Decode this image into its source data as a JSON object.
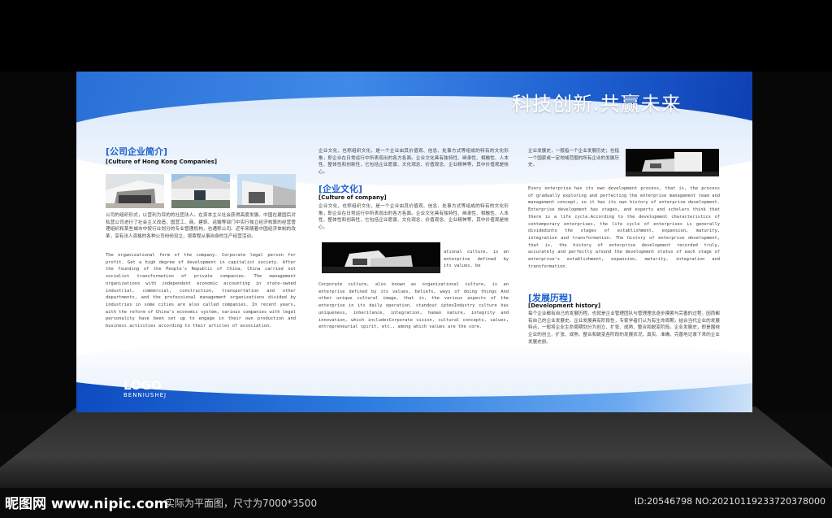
{
  "slogan": "科技创新.共赢未来",
  "logo": {
    "text": "LOGO",
    "sub": "BENNIUSHEJ"
  },
  "about": {
    "title_cn": "[公司企业简介]",
    "title_en": "[Culture of Hong Kong Companies]",
    "body_cn": "公司的组织形式，以营利为目的的社团法人。在资本主义社会获得高度发展。中国在建国后对私营公司进行了社会主义改造，国营工、商、建筑、运输等部门中实行独立经济核算的经营管理组织和某些城市中按行业划分的专业管理机构，也通称公司。近年来随着中国经济体制的改革，享有法人资格的各种公司纷纷设立，按章程从事自身的生产经营活动。",
    "body_en": "The organizational form of the company. Corporate legal person for profit. Get a high degree of development in capitalist society. After the founding of the People's Republic of China, China carried out socialist transformation of private companies. The management organizations with independent economic accounting in state-owned industrial, commercial, construction, transportation and other departments, and the professional management organizations divided by industries in some cities are also called companies. In recent years, with the reform of China's economic system, various companies with legal personality have been set up to engage in their own production and business activities according to their articles of association."
  },
  "culture": {
    "title_cn": "[企业文化]",
    "title_en": "[Culture of company]",
    "intro_cn": "企业文化，也称组织文化，是一个企业由其价值观、信念、处事方式等组成的特有的文化形象，即企业在日常运行中所表现出的各方各面。企业文化具有独特性、继承性、相融性、人本性、整体性和创新性，它包括企业愿景、文化观念、价值观念、企业精神等，其中价值观是核心。",
    "body_cn": "企业文化，也称组织文化，是一个企业由其价值观、信念、处事方式等组成的特有的文化形象，即企业在日常运行中所表现出的各方各面。企业文化具有独特性、继承性、相融性、人本性、整体性和创新性，它包括企业愿景、文化观念、价值观念、企业精神等，其中价值观是核心。",
    "side_en": "ational culture, is an enterprise defined by its values, be",
    "body_en": "Corporate culture, also known as organizational culture, is an enterprise defined by its values, beliefs, ways of doing things And other unique cultural image, that is, the various aspects of the enterprise in its daily operation. standout ipteoIndustry culture has uniqueness, inheritance, integration, human nature, integrity and innovation, which includesCorporate vision, cultural concepts, values, entrepreneurial spirit, etc., among which values are the core."
  },
  "development": {
    "intro_cn": "企业发展史，一般指一个企业发展历史；也指一个国家或一定地域范围的所有企业的发展历史。",
    "body_en": "Every enterprise has its own development process, that is, the process of gradually exploring and perfecting the enterprise management team and management concept, so it has its own history of enterprise development. Enterprise development has stages, and experts and scholars think that there is a life cycle.According to the development characteristics of contemporary enterprises, the life cycle of enterprises is generally dividedinto the stages of establishment, expansion, maturity, integration and transformation. The history of enterprise development, that is, the history of enterprise development recorded truly, accurately and perfectly around the development status of each stage of enterprise's establishment, expansion, maturity, integration and transformation.",
    "title_cn": "[发展历程]",
    "title_en": "[Development history]",
    "body_cn": "每个企业都有自己的发展历程，也就是企业管理团队与管理理念逐步摸索与完善的过程，因而都有自己的企业发展史。企业发展具有阶段性，专家学者们认为有生命周期，结合当代企业的发展特点，一般将企业生命周期划分为创立、扩张、成熟、整合和蜕变阶段。企业发展史，即是围绕企业的创立、扩张、成熟、整合和蜕变各阶段的发展状况，真实、准确、完善地记录下来的企业发展史册。"
  },
  "watermark": {
    "site": "昵图网 www.nipic.com",
    "note": "实际为平面图，尺寸为7000*3500",
    "id": "ID:20546798 NO:20210119233720378000"
  },
  "colors": {
    "accent": "#1b5fc9",
    "band": "#2a6fd6"
  }
}
